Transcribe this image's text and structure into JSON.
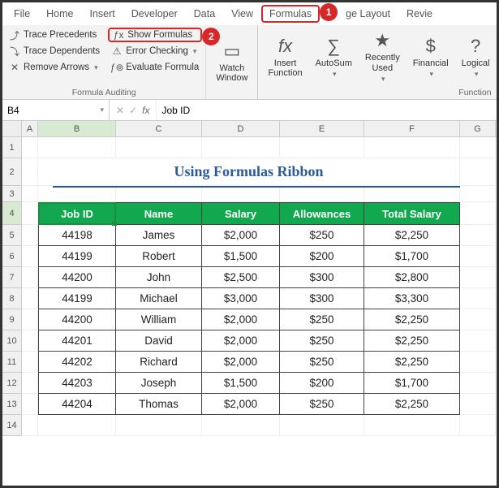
{
  "tabs": {
    "file": "File",
    "home": "Home",
    "insert": "Insert",
    "developer": "Developer",
    "data": "Data",
    "view": "View",
    "formulas": "Formulas",
    "page_layout": "ge Layout",
    "review": "Revie"
  },
  "callouts": {
    "one": "1",
    "two": "2"
  },
  "ribbon": {
    "audit": {
      "trace_precedents": "Trace Precedents",
      "trace_dependents": "Trace Dependents",
      "remove_arrows": "Remove Arrows",
      "show_formulas": "Show Formulas",
      "error_checking": "Error Checking",
      "evaluate_formula": "Evaluate Formula",
      "group_label": "Formula Auditing"
    },
    "watch_window": "Watch\nWindow",
    "insert_function": "Insert\nFunction",
    "autosum": "AutoSum",
    "recently_used": "Recently\nUsed",
    "financial": "Financial",
    "logical": "Logical",
    "function_group": "Function"
  },
  "namebox": {
    "ref": "B4",
    "formula": "Job ID"
  },
  "columns": {
    "A": "A",
    "B": "B",
    "C": "C",
    "D": "D",
    "E": "E",
    "F": "F",
    "G": "G"
  },
  "title": "Using Formulas Ribbon",
  "headers": {
    "job_id": "Job ID",
    "name": "Name",
    "salary": "Salary",
    "allowances": "Allowances",
    "total": "Total Salary"
  },
  "rows": [
    {
      "n": "5",
      "id": "44198",
      "name": "James",
      "salary": "$2,000",
      "allow": "$250",
      "total": "$2,250"
    },
    {
      "n": "6",
      "id": "44199",
      "name": "Robert",
      "salary": "$1,500",
      "allow": "$200",
      "total": "$1,700"
    },
    {
      "n": "7",
      "id": "44200",
      "name": "John",
      "salary": "$2,500",
      "allow": "$300",
      "total": "$2,800"
    },
    {
      "n": "8",
      "id": "44199",
      "name": "Michael",
      "salary": "$3,000",
      "allow": "$300",
      "total": "$3,300"
    },
    {
      "n": "9",
      "id": "44200",
      "name": "William",
      "salary": "$2,000",
      "allow": "$250",
      "total": "$2,250"
    },
    {
      "n": "10",
      "id": "44201",
      "name": "David",
      "salary": "$2,000",
      "allow": "$250",
      "total": "$2,250"
    },
    {
      "n": "11",
      "id": "44202",
      "name": "Richard",
      "salary": "$2,000",
      "allow": "$250",
      "total": "$2,250"
    },
    {
      "n": "12",
      "id": "44203",
      "name": "Joseph",
      "salary": "$1,500",
      "allow": "$200",
      "total": "$1,700"
    },
    {
      "n": "13",
      "id": "44204",
      "name": "Thomas",
      "salary": "$2,000",
      "allow": "$250",
      "total": "$2,250"
    }
  ],
  "rownums": {
    "r1": "1",
    "r2": "2",
    "r3": "3",
    "r4": "4",
    "r14": "14"
  }
}
